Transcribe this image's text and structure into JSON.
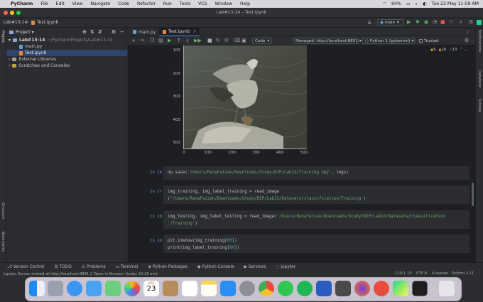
{
  "menubar": {
    "app": "PyCharm",
    "items": [
      "File",
      "Edit",
      "View",
      "Navigate",
      "Code",
      "Refactor",
      "Run",
      "Tools",
      "VCS",
      "Window",
      "Help"
    ],
    "battery": "64%",
    "datetime": "Tue 23 May  11:59 AM"
  },
  "window": {
    "title": "Lab#13-14 – Test.ipynb",
    "project_name": "Lab#13-14",
    "breadcrumb_file": "Test.ipynb",
    "run_config": "main"
  },
  "project_panel": {
    "title": "Project",
    "root": "Lab#13-14",
    "root_path": "~/PycharmProjects/Lab#13-14",
    "files": [
      "main.py",
      "Test.ipynb"
    ],
    "external": "External Libraries",
    "scratches": "Scratches and Consoles"
  },
  "editor": {
    "tabs": [
      {
        "label": "main.py"
      },
      {
        "label": "Test.ipynb"
      }
    ],
    "cell_type": "Code",
    "server": "Managed: http://localhost:8891",
    "kernel": "Python 3 (ipykernel)",
    "trusted": "Trusted",
    "warnings": "9",
    "weak_warnings": "16",
    "typos": "13"
  },
  "plot": {
    "y_ticks": [
      "100",
      "200",
      "300",
      "400",
      "500"
    ],
    "x_ticks": [
      "0",
      "100",
      "200",
      "300",
      "400",
      "500"
    ]
  },
  "cells": [
    {
      "count": "In 16",
      "lines": [
        [
          "np.save(",
          {
            "s": "'/Users/RanaFaizan/Downloads/Study/DIP/Lab13/Training.npy'"
          },
          ", imgs)"
        ]
      ]
    },
    {
      "count": "In 17",
      "lines": [
        [
          "img_training, img_label_training = read_image"
        ],
        [
          "(",
          {
            "s": "'/Users/RanaFaizan/Downloads/Study/DIP/Lab13/Datasets/classification/Training'"
          },
          ")"
        ]
      ]
    },
    {
      "count": "In 18",
      "lines": [
        [
          "img_testing, img_label_testing = read_image(",
          {
            "s": "'/Users/RanaFaizan/Downloads/Study/DIP/Lab13/Datasets/classification"
          }
        ],
        [
          {
            "s": "'/Training'"
          },
          ")"
        ]
      ]
    },
    {
      "count": "In 19",
      "lines": [
        [
          "plt.imshow(img_training[",
          {
            "n": "80"
          },
          "])"
        ],
        [
          "print(img_label_training[",
          {
            "n": "80"
          },
          "])"
        ]
      ]
    }
  ],
  "bottom_tools": [
    "Version Control",
    "TODO",
    "Problems",
    "Terminal",
    "Python Packages",
    "Python Console",
    "Services",
    "Jupyter"
  ],
  "status": {
    "message": "Jupyter Server started at http://localhost:8891 // Open in Browser (today 10:25 am)",
    "position": "110:1",
    "line_sep": "LF",
    "encoding": "UTF-8",
    "indent": "4 spaces",
    "interpreter": "Python 3.11"
  },
  "right_panels": [
    "Notifications",
    "Database",
    "SciView"
  ],
  "left_panels": [
    "Project",
    "Structure",
    "Bookmarks"
  ],
  "dock": {
    "calendar_month": "MAY",
    "calendar_day": "23"
  }
}
